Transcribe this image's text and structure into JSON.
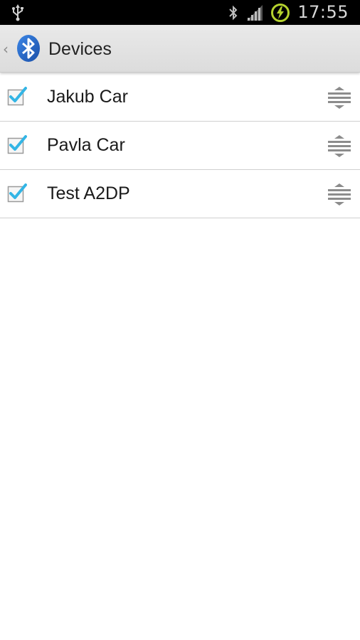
{
  "status_bar": {
    "time": "17:55",
    "icons": [
      "usb-icon",
      "bluetooth-icon",
      "signal-icon",
      "battery-charging-icon"
    ]
  },
  "action_bar": {
    "title": "Devices",
    "up_icon": "chevron-left-icon",
    "app_icon": "bluetooth-logo-icon"
  },
  "devices": [
    {
      "name": "Jakub Car",
      "checked": true
    },
    {
      "name": "Pavla Car",
      "checked": true
    },
    {
      "name": "Test A2DP",
      "checked": true
    }
  ],
  "colors": {
    "accent": "#33b5e5",
    "bluetooth_blue": "#1f5fc4",
    "battery_green": "#b5d22e"
  }
}
